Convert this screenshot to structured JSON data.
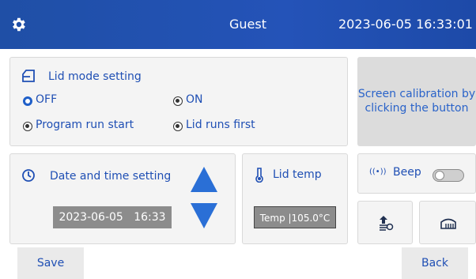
{
  "header": {
    "user": "Guest",
    "datetime": "2023-06-05 16:33:01",
    "icon": "gear-icon",
    "bg_color": "#1f4fa6"
  },
  "lid_mode": {
    "title": "Lid mode setting",
    "options": {
      "off": "OFF",
      "on": "ON",
      "program_run_start": "Program run start",
      "lid_runs_first": "Lid runs first"
    },
    "selected": "OFF"
  },
  "calibration": {
    "line1": "Screen calibration by",
    "line2": "clicking the button"
  },
  "date_time": {
    "title": "Date and time setting",
    "date": "2023-06-05",
    "time": "16:33"
  },
  "lid_temp": {
    "title": "Lid temp",
    "label": "Temp",
    "value": "105.0°C"
  },
  "beep": {
    "label": "Beep",
    "enabled": false
  },
  "buttons": {
    "save": "Save",
    "back": "Back"
  },
  "colors": {
    "accent": "#2a6fd6",
    "text_blue": "#1f4fb4"
  }
}
